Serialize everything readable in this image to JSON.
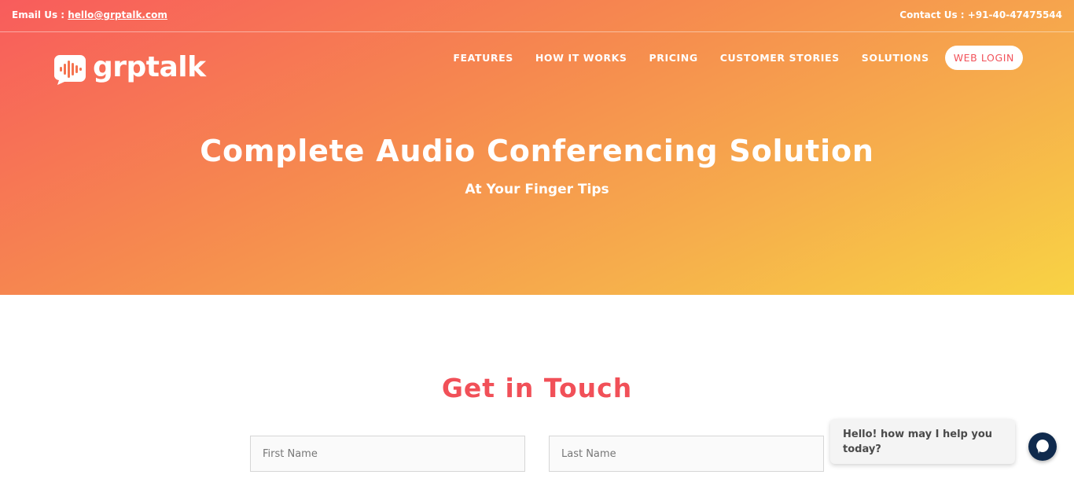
{
  "topbar": {
    "email_label": "Email Us : ",
    "email": "hello@grptalk.com",
    "contact": "Contact Us : +91-40-47475544"
  },
  "brand": {
    "name": "grptalk"
  },
  "nav": {
    "items": [
      {
        "label": "FEATURES"
      },
      {
        "label": "HOW IT WORKS"
      },
      {
        "label": "PRICING"
      },
      {
        "label": "CUSTOMER STORIES"
      },
      {
        "label": "SOLUTIONS"
      }
    ],
    "login": "WEB LOGIN"
  },
  "hero": {
    "title": "Complete Audio Conferencing Solution",
    "subtitle": "At Your Finger Tips"
  },
  "contact_form": {
    "title": "Get in Touch",
    "first_name_placeholder": "First Name",
    "last_name_placeholder": "Last Name"
  },
  "chat": {
    "message": "Hello! how may I help you today?"
  },
  "colors": {
    "accent": "#f15058",
    "chat_button": "#0f2a4d"
  }
}
